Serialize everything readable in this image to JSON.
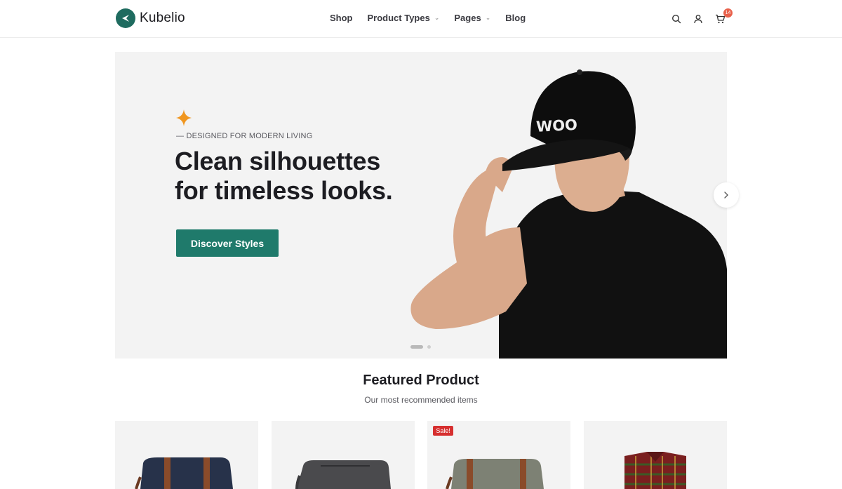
{
  "brand": {
    "name": "Kubelio",
    "color": "#1e6b5f"
  },
  "nav": {
    "items": [
      {
        "label": "Shop",
        "has_dropdown": false
      },
      {
        "label": "Product Types",
        "has_dropdown": true
      },
      {
        "label": "Pages",
        "has_dropdown": true
      },
      {
        "label": "Blog",
        "has_dropdown": false
      }
    ]
  },
  "header_icons": {
    "search": "search-icon",
    "account": "user-icon",
    "cart": "cart-icon",
    "cart_count": "14",
    "badge_color": "#e8604a"
  },
  "hero": {
    "eyebrow": "— DESIGNED FOR MODERN LIVING",
    "headline_line1": "Clean silhouettes",
    "headline_line2": "for timeless looks.",
    "cta_label": "Discover Styles",
    "cta_color": "#1f7a6b",
    "star_color": "#f0961f",
    "cap_text": "WOO",
    "slides_total": 2,
    "active_slide": 1
  },
  "featured": {
    "title": "Featured Product",
    "subtitle": "Our most recommended items",
    "products": [
      {
        "name": "navy-messenger-bag-image",
        "sale": false
      },
      {
        "name": "gray-tech-bag-image",
        "sale": false
      },
      {
        "name": "olive-messenger-bag-image",
        "sale": true,
        "badge": "Sale!"
      },
      {
        "name": "plaid-shirt-image",
        "sale": false
      }
    ]
  }
}
